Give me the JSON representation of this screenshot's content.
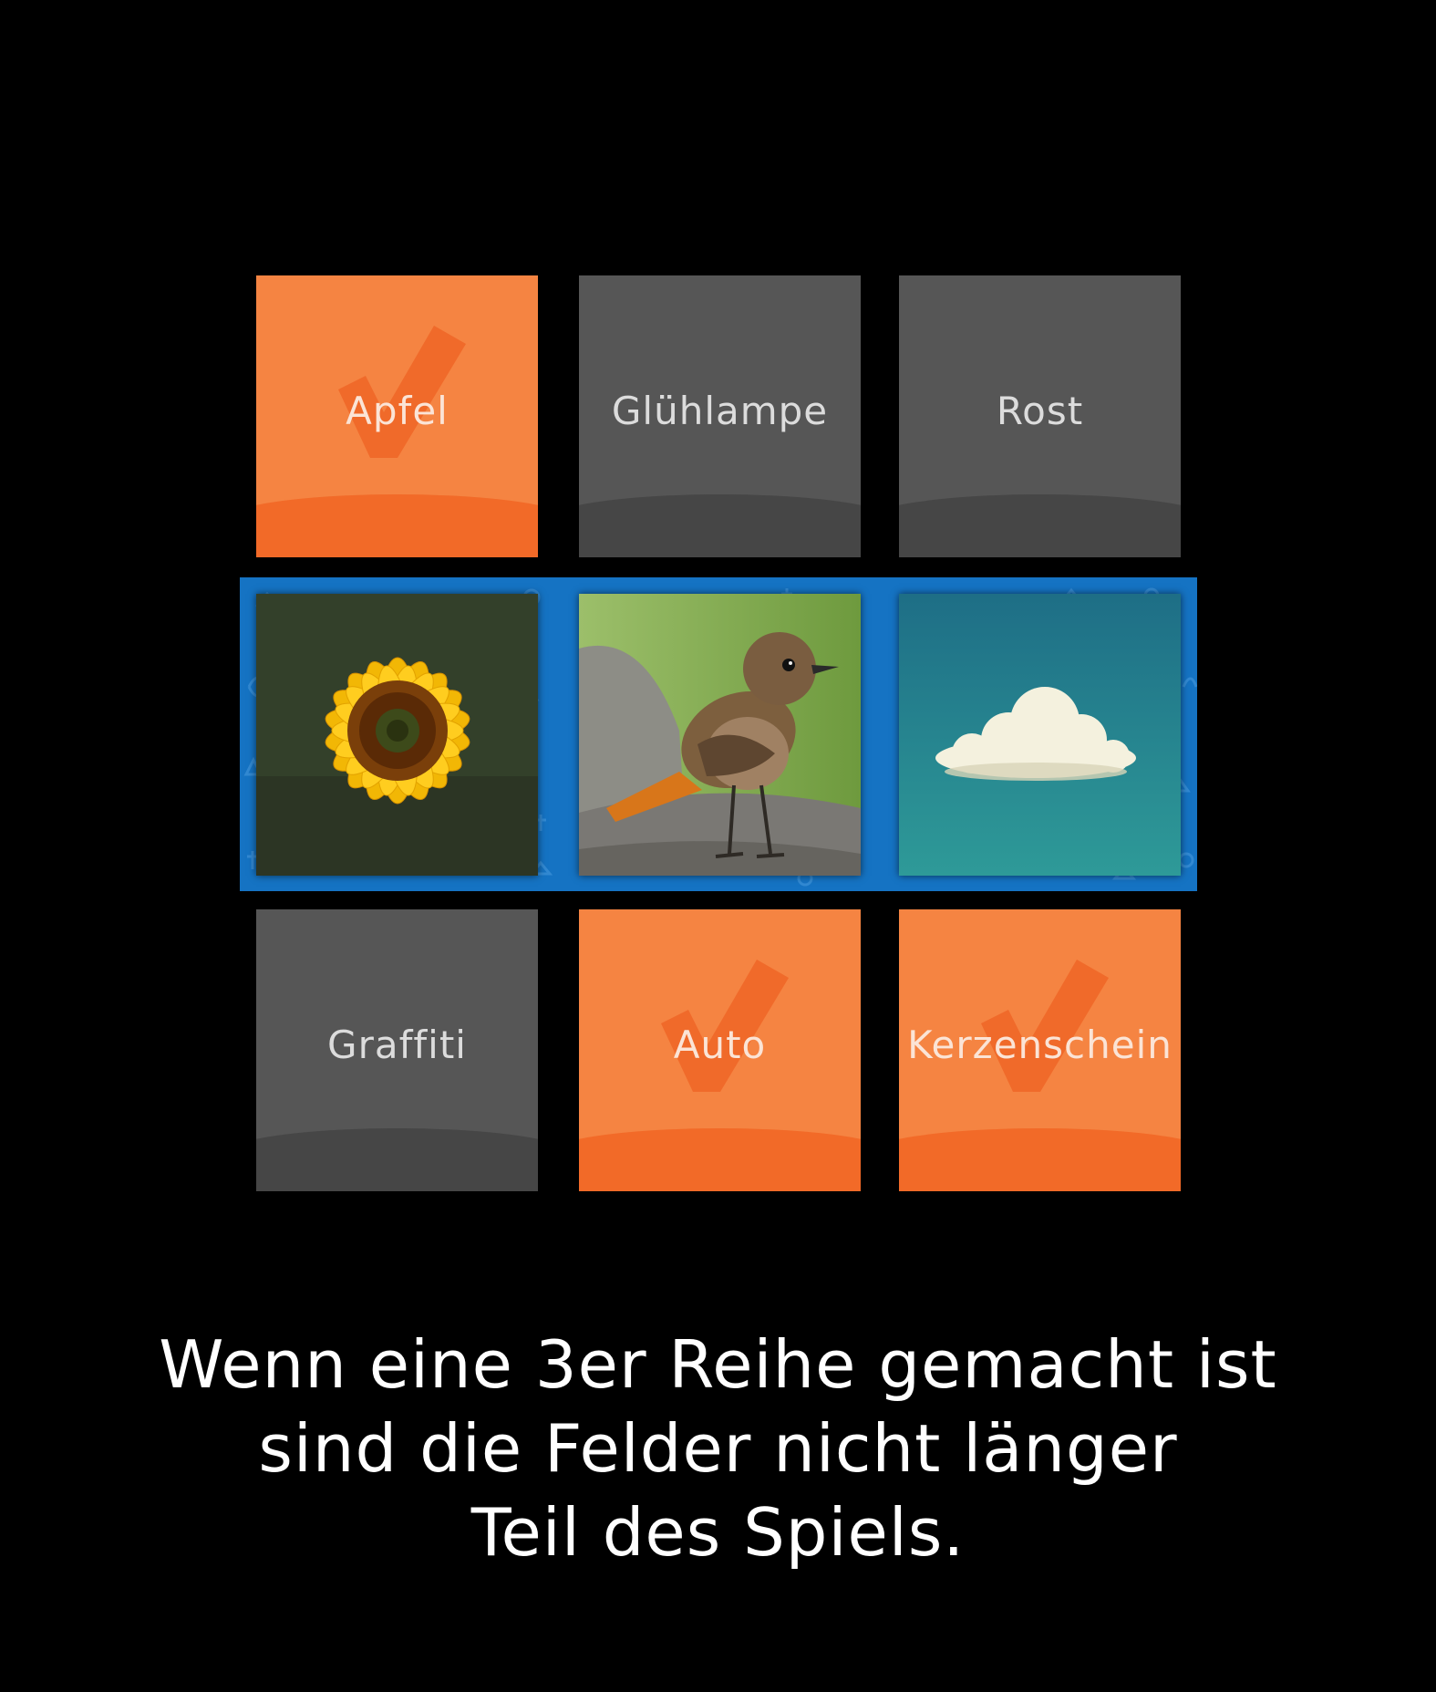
{
  "board": {
    "top_row": [
      {
        "label": "Apfel",
        "state": "checked",
        "color": "#f58442"
      },
      {
        "label": "Glühlampe",
        "state": "open",
        "color": "#565656"
      },
      {
        "label": "Rost",
        "state": "open",
        "color": "#565656"
      }
    ],
    "middle_row": [
      {
        "image": "sunflower"
      },
      {
        "image": "bird"
      },
      {
        "image": "cloud"
      }
    ],
    "bottom_row": [
      {
        "label": "Graffiti",
        "state": "open",
        "color": "#565656"
      },
      {
        "label": "Auto",
        "state": "checked",
        "color": "#f58442"
      },
      {
        "label": "Kerzenschein",
        "state": "checked",
        "color": "#f58442"
      }
    ],
    "strip_color": "#1573c3"
  },
  "caption": {
    "line1": "Wenn eine 3er Reihe gemacht ist",
    "line2": "sind die Felder nicht länger",
    "line3": "Teil des Spiels."
  }
}
